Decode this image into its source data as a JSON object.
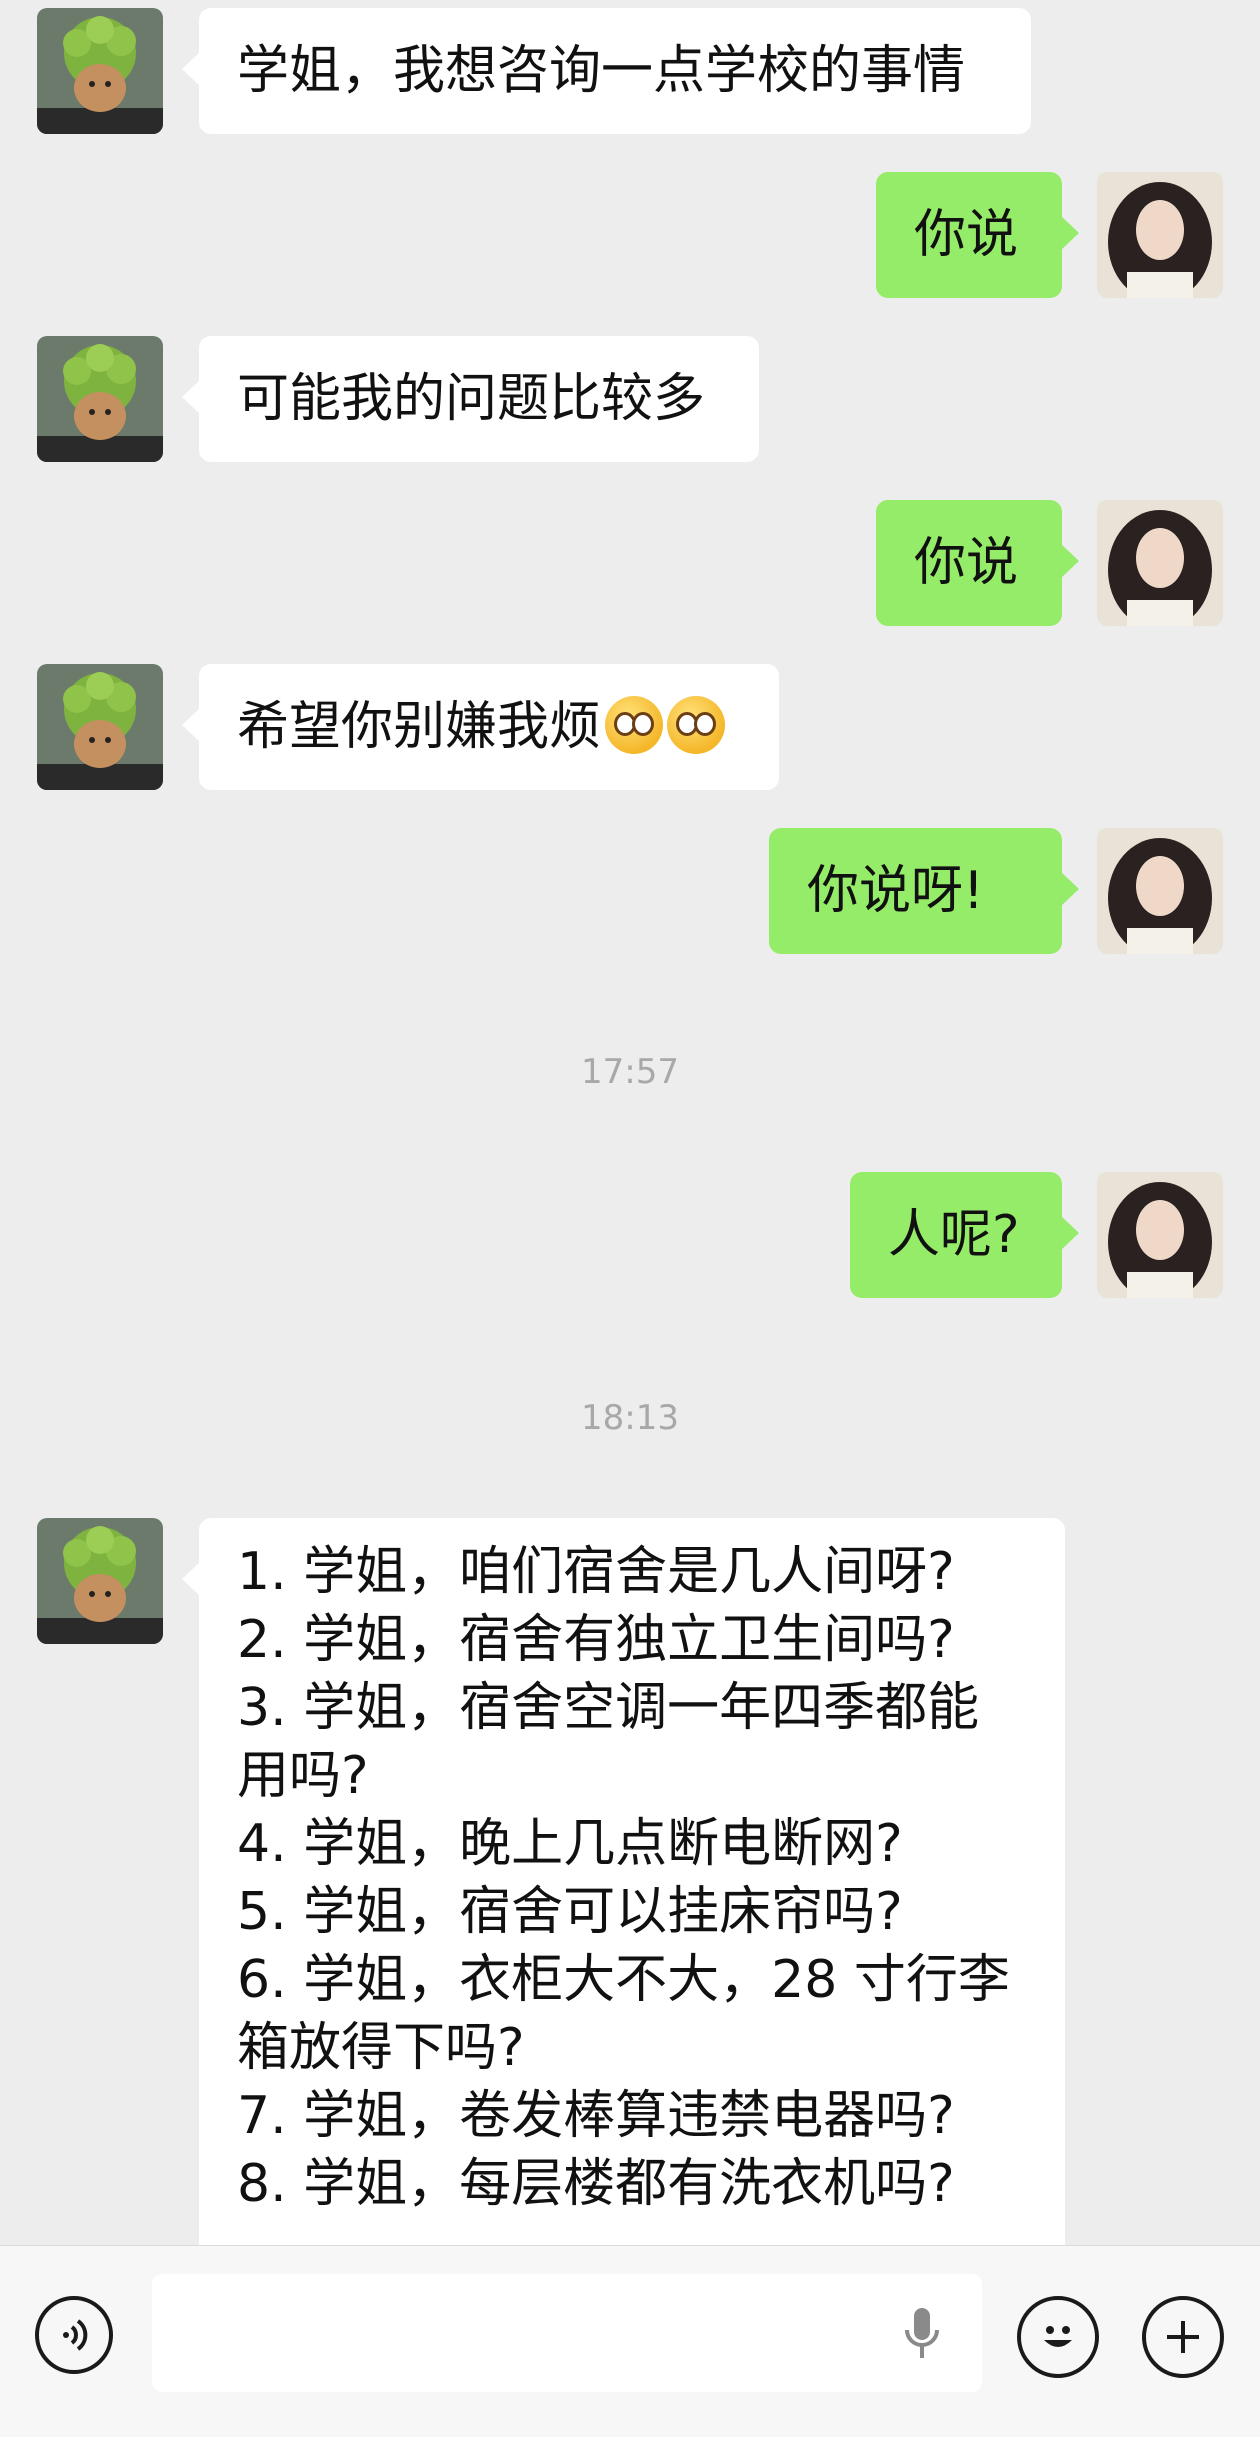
{
  "messages": [
    {
      "side": "in",
      "text": "学姐，我想咨询一点学校的事情"
    },
    {
      "side": "out",
      "text": "你说"
    },
    {
      "side": "in",
      "text": "可能我的问题比较多"
    },
    {
      "side": "out",
      "text": "你说"
    },
    {
      "side": "in",
      "text": "希望你别嫌我烦",
      "emoji": "pleading-face-emoji"
    },
    {
      "side": "out",
      "text": "你说呀!"
    },
    {
      "type": "timestamp",
      "text": "17:57"
    },
    {
      "side": "out",
      "text": "人呢?"
    },
    {
      "type": "timestamp",
      "text": "18:13"
    },
    {
      "side": "in",
      "lines": [
        "1. 学姐，咱们宿舍是几人间呀?",
        "2. 学姐，宿舍有独立卫生间吗?",
        "3. 学姐，宿舍空调一年四季都能用吗?",
        "4. 学姐，晚上几点断电断网?",
        "5. 学姐，宿舍可以挂床帘吗?",
        "6. 学姐，衣柜大不大，28 寸行李箱放得下吗?",
        "7. 学姐，卷发棒算违禁电器吗?",
        "8. 学姐，每层楼都有洗衣机吗?"
      ]
    }
  ],
  "input_bar": {
    "voice_icon": "voice-icon",
    "mic_icon": "microphone-icon",
    "emoji_icon": "emoji-icon",
    "plus_icon": "plus-icon"
  },
  "colors": {
    "background": "#ededed",
    "incoming": "#ffffff",
    "outgoing": "#95ec69"
  }
}
